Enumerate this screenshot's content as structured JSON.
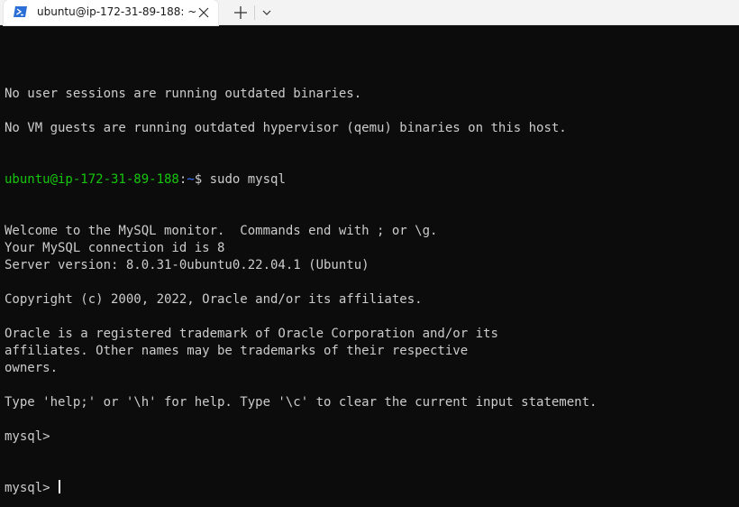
{
  "tab": {
    "title": "ubuntu@ip-172-31-89-188: ~",
    "icon": "powershell-icon"
  },
  "tabbar": {
    "close_icon": "close-icon",
    "new_tab_icon": "plus-icon",
    "dropdown_icon": "chevron-down-icon"
  },
  "colors": {
    "background": "#0c0c0c",
    "text": "#cccccc",
    "prompt_user": "#16c60c",
    "prompt_path": "#3b78ff"
  },
  "terminal": {
    "lines_before_prompt": [
      "",
      "No user sessions are running outdated binaries.",
      "",
      "No VM guests are running outdated hypervisor (qemu) binaries on this host."
    ],
    "prompt": {
      "user_host": "ubuntu@ip-172-31-89-188",
      "colon": ":",
      "path": "~",
      "symbol": "$ ",
      "command": "sudo mysql"
    },
    "lines_after_prompt": [
      "Welcome to the MySQL monitor.  Commands end with ; or \\g.",
      "Your MySQL connection id is 8",
      "Server version: 8.0.31-0ubuntu0.22.04.1 (Ubuntu)",
      "",
      "Copyright (c) 2000, 2022, Oracle and/or its affiliates.",
      "",
      "Oracle is a registered trademark of Oracle Corporation and/or its",
      "affiliates. Other names may be trademarks of their respective",
      "owners.",
      "",
      "Type 'help;' or '\\h' for help. Type '\\c' to clear the current input statement.",
      "",
      "mysql> "
    ],
    "current_prompt": "mysql> "
  }
}
